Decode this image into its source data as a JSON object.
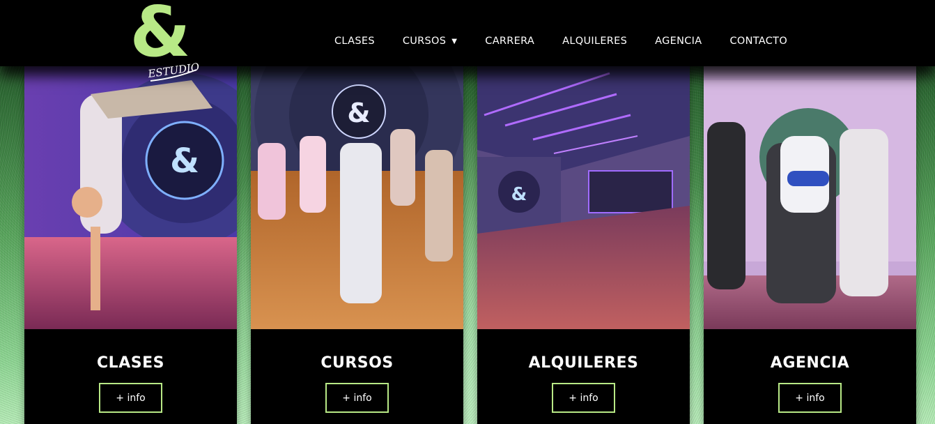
{
  "brand": {
    "logo_symbol": "&",
    "logo_text": "ESTUDIO",
    "accent_color": "#b8e986"
  },
  "nav": {
    "items": [
      {
        "label": "CLASES"
      },
      {
        "label": "CURSOS",
        "has_dropdown": true,
        "caret_icon": "caret-down-icon"
      },
      {
        "label": "CARRERA"
      },
      {
        "label": "ALQUILERES"
      },
      {
        "label": "AGENCIA"
      },
      {
        "label": "CONTACTO"
      }
    ]
  },
  "cards": [
    {
      "title": "CLASES",
      "button": "+ info"
    },
    {
      "title": "CURSOS",
      "button": "+ info"
    },
    {
      "title": "ALQUILERES",
      "button": "+ info"
    },
    {
      "title": "AGENCIA",
      "button": "+ info"
    }
  ]
}
